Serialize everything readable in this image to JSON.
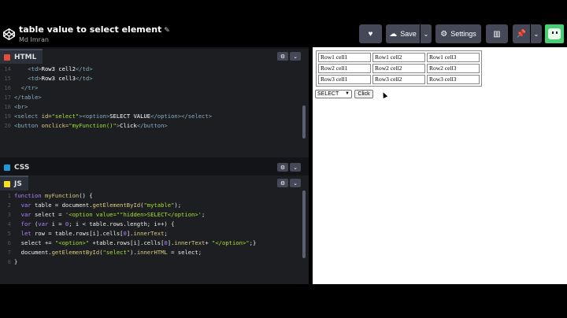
{
  "header": {
    "title": "table value to select element",
    "author": "Md Imran",
    "save_label": "Save",
    "settings_label": "Settings"
  },
  "panes": {
    "html": {
      "label": "HTML",
      "lines": [
        {
          "n": "14",
          "html": "<span class='tag'>    &lt;td&gt;</span><span class='txt'>Row3 cell2</span><span class='tag'>&lt;/td&gt;</span>"
        },
        {
          "n": "15",
          "html": "<span class='tag'>    &lt;td&gt;</span><span class='txt'>Row3 cell3</span><span class='tag'>&lt;/td&gt;</span>"
        },
        {
          "n": "16",
          "html": "<span class='tag'>  &lt;/tr&gt;</span>"
        },
        {
          "n": "17",
          "html": "<span class='tag'>&lt;/table&gt;</span>"
        },
        {
          "n": "18",
          "html": "<span class='tag'>&lt;br&gt;</span>"
        },
        {
          "n": "19",
          "html": "<span class='tag'>&lt;select </span><span class='attr'>id=</span><span class='str'>\"select\"</span><span class='tag'>&gt;&lt;option&gt;</span><span class='txt'>SELECT VALUE</span><span class='tag'>&lt;/option&gt;&lt;/select&gt;</span>"
        },
        {
          "n": "20",
          "html": "<span class='tag'>&lt;button </span><span class='attr'>onclick=</span><span class='str'>\"myFunction()\"</span><span class='tag'>&gt;</span><span class='txt'>Click</span><span class='tag'>&lt;/button&gt;</span>"
        }
      ]
    },
    "css": {
      "label": "CSS"
    },
    "js": {
      "label": "JS",
      "lines": [
        {
          "n": "1",
          "html": "<span class='kw'>function</span> <span class='fn'>myFunction</span><span class='plain'>() {</span>"
        },
        {
          "n": "2",
          "html": "<span class='plain'>  </span><span class='kw'>var</span><span class='plain'> table = document.</span><span class='fn'>getElementById</span><span class='plain'>(</span><span class='str'>\"mytable\"</span><span class='plain'>);</span>"
        },
        {
          "n": "3",
          "html": "<span class='plain'>  </span><span class='kw'>var</span><span class='plain'> select = </span><span class='str'>'&lt;option value=\"\"hidden&gt;SELECT&lt;/option&gt;'</span><span class='plain'>;</span>"
        },
        {
          "n": "4",
          "html": "<span class='plain'>  </span><span class='kw'>for</span><span class='plain'> (</span><span class='kw'>var</span><span class='plain'> i = </span><span class='kw'>0</span><span class='plain'>; i &lt; table.rows.length; i++) {</span>"
        },
        {
          "n": "5",
          "html": "<span class='plain'>  </span><span class='kw'>let</span><span class='plain'> row = table.rows[i].cells[</span><span class='kw'>0</span><span class='plain'>].</span><span class='fn'>innerText</span><span class='plain'>;</span>"
        },
        {
          "n": "6",
          "html": "<span class='plain'>  select += </span><span class='str'>\"&lt;option&gt;\"</span><span class='plain'> +table.rows[i].cells[</span><span class='kw'>0</span><span class='plain'>].</span><span class='fn'>innerText</span><span class='plain'>+ </span><span class='str'>\"&lt;/option&gt;\"</span><span class='plain'>;}</span>"
        },
        {
          "n": "7",
          "html": "<span class='plain'>  document.</span><span class='fn'>getElementById</span><span class='plain'>(</span><span class='str'>\"select\"</span><span class='plain'>).</span><span class='fn'>innerHTML</span><span class='plain'> = select;</span>"
        },
        {
          "n": "8",
          "html": "<span class='plain'>}</span>"
        }
      ]
    }
  },
  "result": {
    "table": [
      [
        "Row1 cell1",
        "Row1 cell2",
        "Row1 cell3"
      ],
      [
        "Row2 cell1",
        "Row2 cell2",
        "Row2 cell3"
      ],
      [
        "Row3 cell1",
        "Row3 cell2",
        "Row3 cell3"
      ]
    ],
    "select_value": "SELECT",
    "button_label": "Click"
  },
  "colors": {
    "html": "#e44d3a",
    "css": "#1b9ad7",
    "js": "#f7df1e",
    "accent": "#47cf73"
  }
}
